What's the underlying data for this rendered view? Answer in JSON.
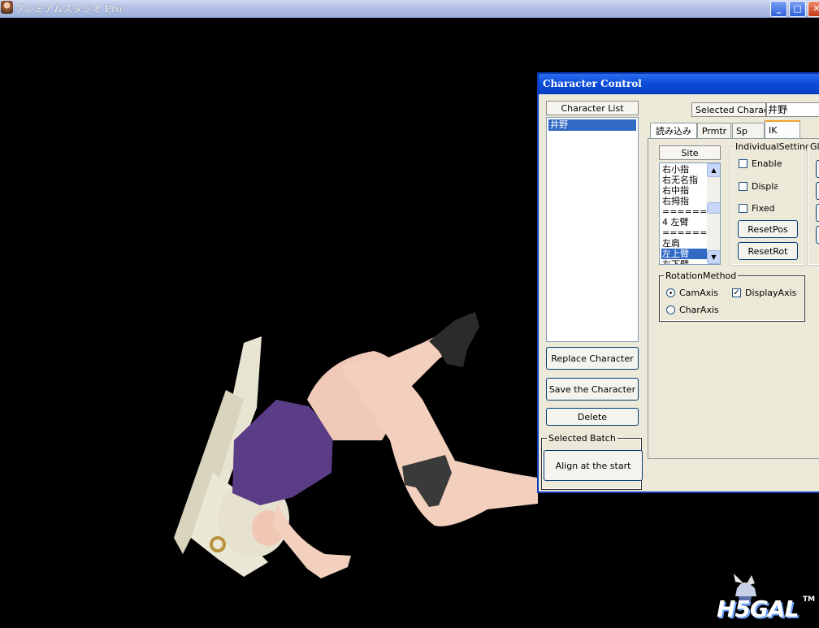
{
  "window": {
    "title": "プレミアムスタジオ Pro",
    "minimize_glyph": "_",
    "maximize_glyph": "□",
    "close_glyph": "✕"
  },
  "dialog": {
    "title": "Character Control",
    "character_list": {
      "header": "Character List",
      "items": [
        "井野"
      ],
      "selected_index": 0
    },
    "buttons": {
      "replace": "Replace Character",
      "save": "Save the Character",
      "delete": "Delete"
    },
    "selected_batch": {
      "legend": "Selected Batch",
      "align_button": "Align at the start"
    },
    "selected_character": {
      "label": "Selected Characte",
      "value": "井野"
    },
    "tabs": [
      "読み込み",
      "Prmtr",
      "Sp",
      "IK"
    ],
    "active_tab": "IK",
    "site": {
      "header": "Site",
      "items": [
        "右小指",
        "右无名指",
        "右中指",
        "右拇指",
        "=========",
        "4 左臂",
        "=========",
        "左肩",
        "左上臂",
        "左下臂"
      ],
      "selected_item": "左上臂"
    },
    "individual_settings": {
      "legend": "IndividualSettings",
      "enable": "Enable",
      "display": "Display",
      "fixed": "Fixed",
      "reset_pos": "ResetPos",
      "reset_rot": "ResetRot"
    },
    "global_legend": "Glo",
    "rotation_method": {
      "legend": "RotationMethod",
      "cam_axis": "CamAxis",
      "char_axis": "CharAxis",
      "display_axis": "DisplayAxis",
      "display_axis_checked": true,
      "selected": "CamAxis"
    }
  },
  "watermark": {
    "text": "H5GAL",
    "tm": "TM"
  },
  "colors": {
    "viewport_bg": "#000000",
    "dialog_bg": "#ece9d8",
    "titlebar_blue": "#0a4bd8",
    "selection": "#316ac5"
  }
}
